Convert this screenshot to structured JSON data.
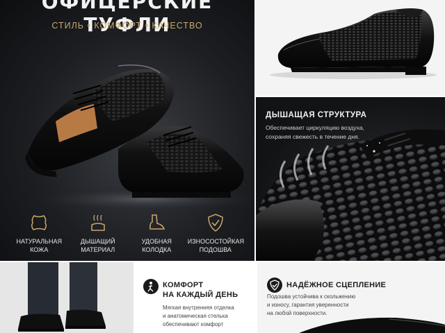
{
  "hero": {
    "title": "ОФИЦЕРСКИЕ ТУФЛИ",
    "tagline": "СТИЛЬ • КОМФОРТ • КАЧЕСТВО",
    "features": [
      {
        "icon": "leather-hide-icon",
        "line1": "НАТУРАЛЬНАЯ",
        "line2": "КОЖА"
      },
      {
        "icon": "breathable-material-icon",
        "line1": "ДЫШАЩИЙ",
        "line2": "МАТЕРИАЛ"
      },
      {
        "icon": "shoe-last-icon",
        "line1": "УДОБНАЯ",
        "line2": "КОЛОДКА"
      },
      {
        "icon": "shield-check-icon",
        "line1": "ИЗНОСОСТОЙКАЯ",
        "line2": "ПОДОШВА"
      }
    ]
  },
  "breathable": {
    "title": "ДЫШАЩАЯ СТРУКТУРА",
    "line1": "Обеспечивает циркуляцию воздуха,",
    "line2": "сохраняя свежесть в течение дня."
  },
  "comfort": {
    "title_line1": "КОМФОРТ",
    "title_line2": "НА КАЖДЫЙ ДЕНЬ",
    "line1": "Мягкая внутренняя отделка",
    "line2": "и анатомическая стелька",
    "line3": "обеспечивают комфорт"
  },
  "grip": {
    "title": "НАДЁЖНОЕ СЦЕПЛЕНИЕ",
    "line1": "Подошва устойчива к скольжению",
    "line2": "и износу, гарантия уверенности",
    "line3": "на любой поверхности."
  },
  "colors": {
    "accent_gold": "#c9a86b",
    "dark_bg": "#1c1e22",
    "leather": "#0e0e0f",
    "lining": "#b87a45"
  }
}
